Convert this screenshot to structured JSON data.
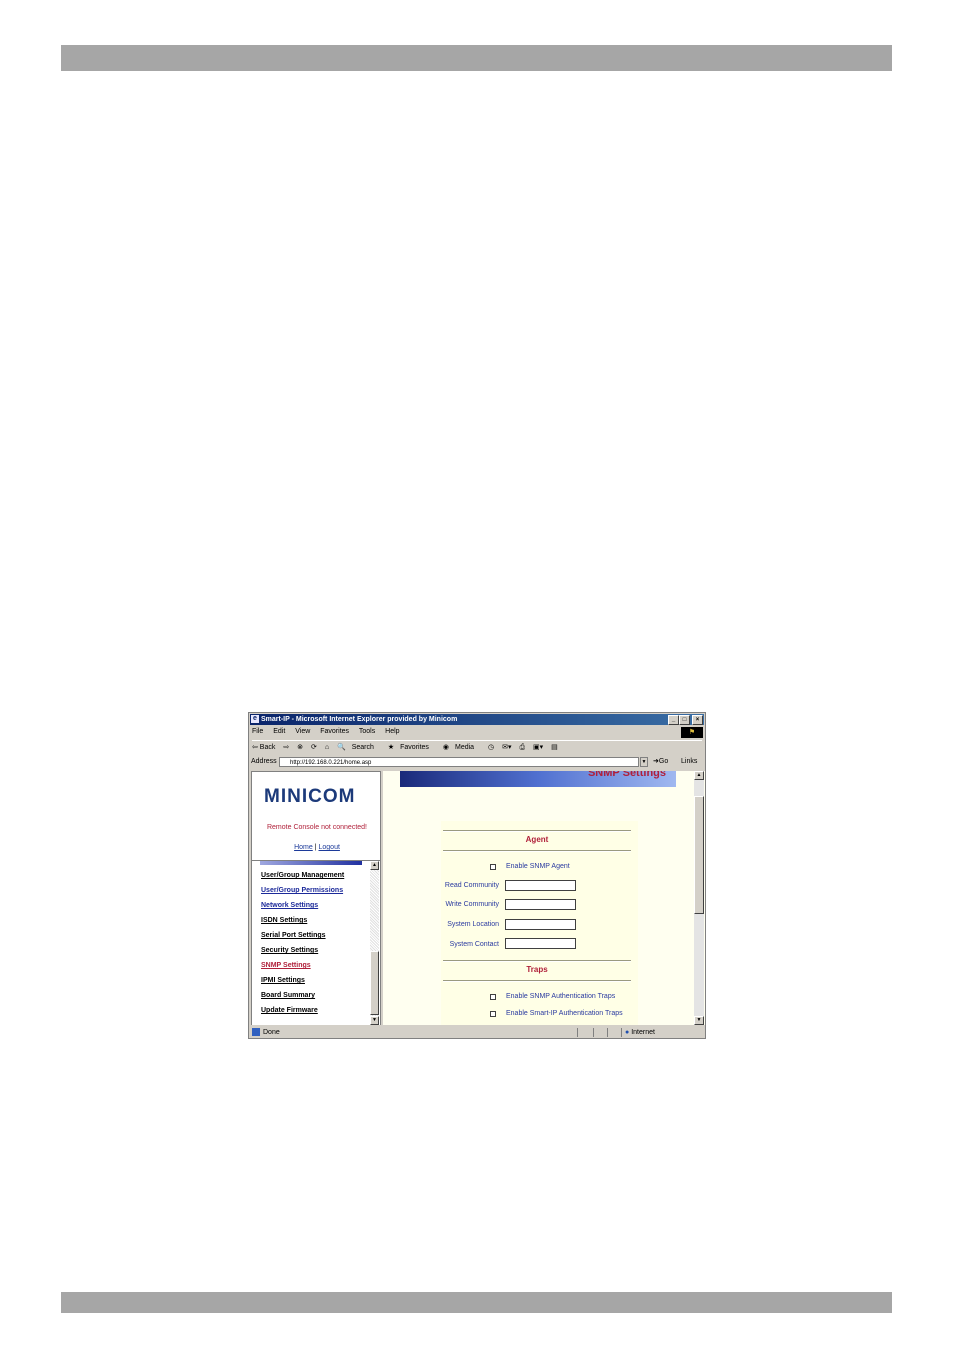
{
  "window": {
    "title": "Smart-IP - Microsoft Internet Explorer provided by Minicom",
    "buttons": [
      "_",
      "□",
      "×"
    ]
  },
  "menu": [
    "File",
    "Edit",
    "View",
    "Favorites",
    "Tools",
    "Help"
  ],
  "toolbar": {
    "back": "⇦ Back",
    "forward": "⇨",
    "search": "Search",
    "favorites": "Favorites",
    "media": "Media"
  },
  "address": {
    "label": "Address",
    "value": "http://192.168.0.221/home.asp",
    "go": "Go",
    "links": "Links"
  },
  "sidebar": {
    "logo": "MINICOM",
    "remote_status": "Remote Console not connected!",
    "home_link": "Home",
    "separator": "|",
    "logout_link": "Logout",
    "items": [
      {
        "label": "User/Group Management",
        "state": "normal"
      },
      {
        "label": "User/Group Permissions",
        "state": "visited"
      },
      {
        "label": "Network Settings",
        "state": "visited"
      },
      {
        "label": "ISDN Settings",
        "state": "normal"
      },
      {
        "label": "Serial Port Settings",
        "state": "normal"
      },
      {
        "label": "Security Settings",
        "state": "normal"
      },
      {
        "label": "SNMP Settings",
        "state": "active"
      },
      {
        "label": "IPMI Settings",
        "state": "normal"
      },
      {
        "label": "Board Summary",
        "state": "normal"
      },
      {
        "label": "Update Firmware",
        "state": "normal"
      }
    ]
  },
  "main": {
    "header_title": "SNMP Settings",
    "agent": {
      "title": "Agent",
      "enable_label": "Enable SNMP Agent",
      "fields": [
        {
          "label": "Read Community",
          "value": ""
        },
        {
          "label": "Write Community",
          "value": ""
        },
        {
          "label": "System Location",
          "value": ""
        },
        {
          "label": "System Contact",
          "value": ""
        }
      ]
    },
    "traps": {
      "title": "Traps",
      "auth_traps_label": "Enable SNMP Authentication Traps",
      "smartip_traps_label": "Enable Smart-IP Authentication Traps"
    }
  },
  "status": {
    "text": "Done",
    "zone": "Internet"
  },
  "colors": {
    "accent_red": "#b0203a",
    "label_blue": "#2a3aa0",
    "title_bar": "#0a246a"
  }
}
